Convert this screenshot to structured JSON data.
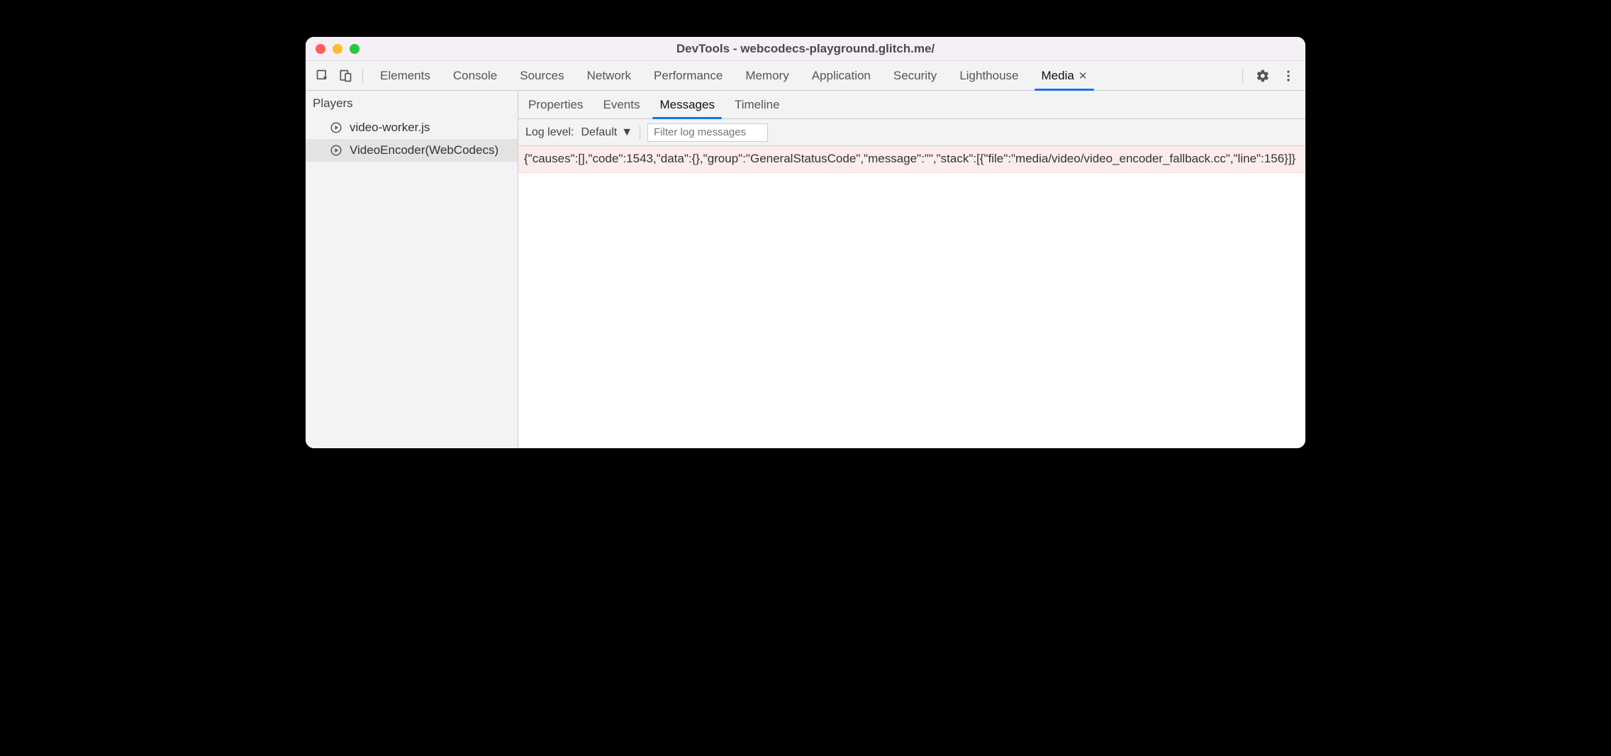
{
  "window": {
    "title": "DevTools - webcodecs-playground.glitch.me/"
  },
  "toolbar": {
    "tabs": [
      {
        "label": "Elements"
      },
      {
        "label": "Console"
      },
      {
        "label": "Sources"
      },
      {
        "label": "Network"
      },
      {
        "label": "Performance"
      },
      {
        "label": "Memory"
      },
      {
        "label": "Application"
      },
      {
        "label": "Security"
      },
      {
        "label": "Lighthouse"
      },
      {
        "label": "Media",
        "active": true,
        "closable": true
      }
    ]
  },
  "sidebar": {
    "title": "Players",
    "players": [
      {
        "label": "video-worker.js"
      },
      {
        "label": "VideoEncoder(WebCodecs)",
        "selected": true
      }
    ]
  },
  "subtabs": [
    {
      "label": "Properties"
    },
    {
      "label": "Events"
    },
    {
      "label": "Messages",
      "active": true
    },
    {
      "label": "Timeline"
    }
  ],
  "filter": {
    "label": "Log level:",
    "level": "Default",
    "placeholder": "Filter log messages"
  },
  "messages": [
    "{\"causes\":[],\"code\":1543,\"data\":{},\"group\":\"GeneralStatusCode\",\"message\":\"\",\"stack\":[{\"file\":\"media/video/video_encoder_fallback.cc\",\"line\":156}]}"
  ]
}
